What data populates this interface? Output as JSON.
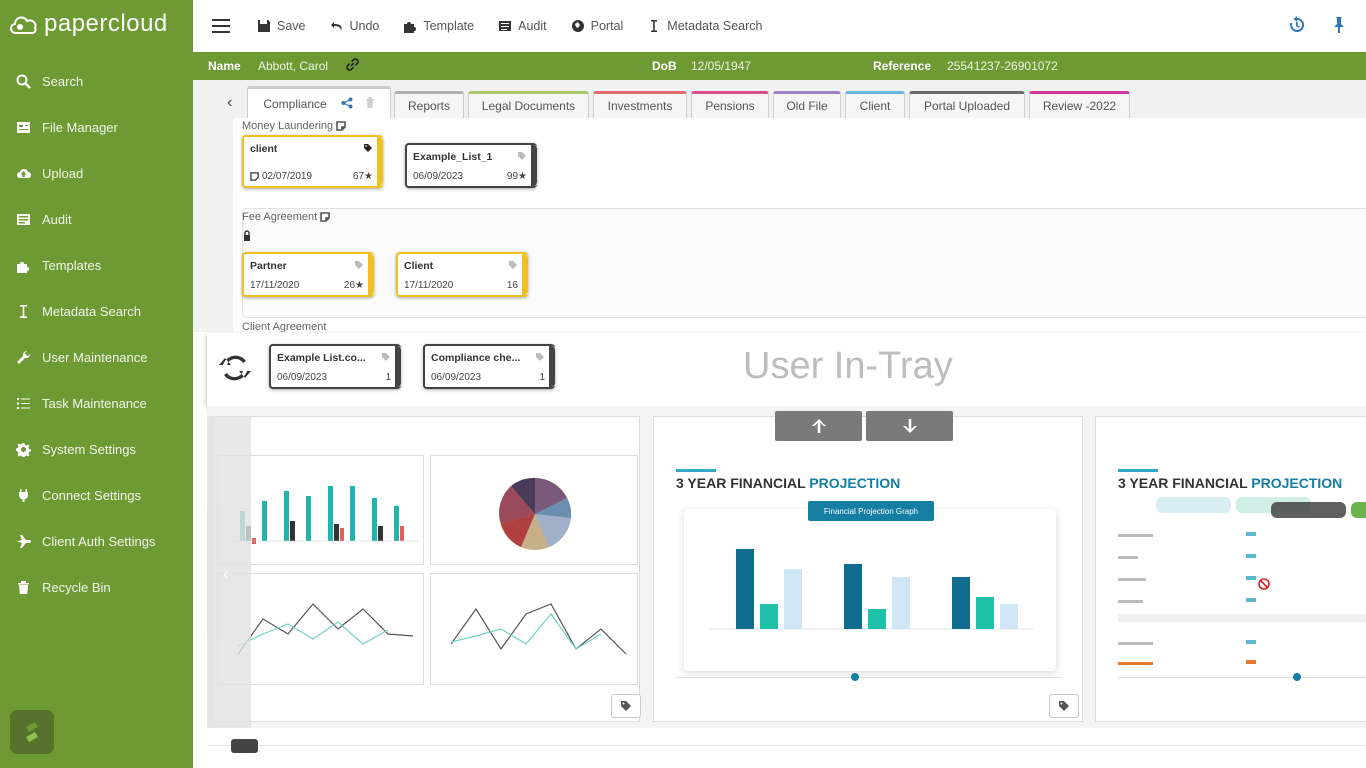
{
  "app": {
    "brand": "papercloud"
  },
  "sidebar": {
    "items": [
      {
        "label": "Search",
        "icon": "search-icon"
      },
      {
        "label": "File Manager",
        "icon": "file-manager-icon"
      },
      {
        "label": "Upload",
        "icon": "upload-icon"
      },
      {
        "label": "Audit",
        "icon": "audit-icon"
      },
      {
        "label": "Templates",
        "icon": "templates-icon"
      },
      {
        "label": "Metadata Search",
        "icon": "metadata-icon"
      },
      {
        "label": "User Maintenance",
        "icon": "wrench-icon"
      },
      {
        "label": "Task Maintenance",
        "icon": "task-list-icon"
      },
      {
        "label": "System Settings",
        "icon": "gear-icon"
      },
      {
        "label": "Connect Settings",
        "icon": "plug-icon"
      },
      {
        "label": "Client Auth Settings",
        "icon": "plane-icon"
      },
      {
        "label": "Recycle Bin",
        "icon": "trash-icon"
      }
    ]
  },
  "toolbar": {
    "save": "Save",
    "undo": "Undo",
    "template": "Template",
    "audit": "Audit",
    "portal": "Portal",
    "metadata_search": "Metadata Search"
  },
  "client": {
    "name_label": "Name",
    "name": "Abbott, Carol",
    "dob_label": "DoB",
    "dob": "12/05/1947",
    "ref_label": "Reference",
    "reference": "25541237-26901072"
  },
  "tabs": [
    {
      "label": "Compliance",
      "color": "#cccccc"
    },
    {
      "label": "Reports",
      "color": "#b0b0b0"
    },
    {
      "label": "Legal Documents",
      "color": "#a6c86b"
    },
    {
      "label": "Investments",
      "color": "#e26b6b"
    },
    {
      "label": "Pensions",
      "color": "#d94f8a"
    },
    {
      "label": "Old File",
      "color": "#a07fc9"
    },
    {
      "label": "Client",
      "color": "#6ab7e0"
    },
    {
      "label": "Portal Uploaded",
      "color": "#6a6a6a"
    },
    {
      "label": "Review -2022",
      "color": "#d0389a"
    }
  ],
  "sections": {
    "money_laundering": "Money Laundering",
    "fee_agreement": "Fee Agreement",
    "client_agreement": "Client Agreement"
  },
  "docs": {
    "ml_client": {
      "name": "client",
      "date": "02/07/2019",
      "count": "67★"
    },
    "ml_example": {
      "name": "Example_List_1",
      "date": "06/09/2023",
      "count": "99★"
    },
    "fee_partner": {
      "name": "Partner",
      "date": "17/11/2020",
      "count": "26★"
    },
    "fee_client": {
      "name": "Client",
      "date": "17/11/2020",
      "count": "16"
    }
  },
  "intray": {
    "title": "User In-Tray",
    "items": [
      {
        "name": "Example List.co...",
        "date": "06/09/2023",
        "count": "1"
      },
      {
        "name": "Compliance che...",
        "date": "06/09/2023",
        "count": "1"
      }
    ]
  },
  "previews": {
    "card2": {
      "title_a": "3 YEAR FINANCIAL ",
      "title_b": "PROJECTION",
      "graph_label": "Financial Projection Graph"
    },
    "card3": {
      "title_a": "3 YEAR FINANCIAL ",
      "title_b": "PROJECTION"
    }
  },
  "colors": {
    "sidebar": "#6e9a34",
    "accent_blue": "#2f78b8",
    "doc_yellow": "#f0c020"
  }
}
